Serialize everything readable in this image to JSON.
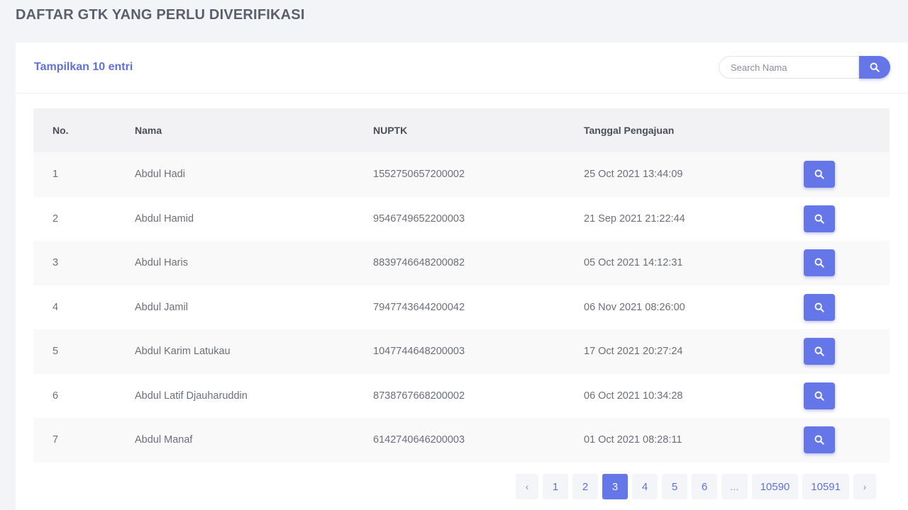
{
  "page_title": "DAFTAR GTK YANG PERLU DIVERIFIKASI",
  "entries_label": "Tampilkan 10 entri",
  "search": {
    "placeholder": "Search Nama",
    "icon": "search-icon"
  },
  "table": {
    "headers": [
      "No.",
      "Nama",
      "NUPTK",
      "Tanggal Pengajuan"
    ],
    "rows": [
      {
        "no": "1",
        "nama": "Abdul Hadi",
        "nuptk": "1552750657200002",
        "tanggal": "25 Oct 2021 13:44:09"
      },
      {
        "no": "2",
        "nama": "Abdul Hamid",
        "nuptk": "9546749652200003",
        "tanggal": "21 Sep 2021 21:22:44"
      },
      {
        "no": "3",
        "nama": "Abdul Haris",
        "nuptk": "8839746648200082",
        "tanggal": "05 Oct 2021 14:12:31"
      },
      {
        "no": "4",
        "nama": "Abdul Jamil",
        "nuptk": "7947743644200042",
        "tanggal": "06 Nov 2021 08:26:00"
      },
      {
        "no": "5",
        "nama": "Abdul Karim Latukau",
        "nuptk": "1047744648200003",
        "tanggal": "17 Oct 2021 20:27:24"
      },
      {
        "no": "6",
        "nama": "Abdul Latif Djauharuddin",
        "nuptk": "8738767668200002",
        "tanggal": "06 Oct 2021 10:34:28"
      },
      {
        "no": "7",
        "nama": "Abdul Manaf",
        "nuptk": "6142740646200003",
        "tanggal": "01 Oct 2021 08:28:11"
      }
    ]
  },
  "pagination": {
    "prev": "‹",
    "pages": [
      "1",
      "2",
      "3",
      "4",
      "5",
      "6",
      "...",
      "10590",
      "10591"
    ],
    "active": "3",
    "next": "›"
  },
  "colors": {
    "accent": "#6476e8",
    "title": "#5a5f6b",
    "link": "#5f72d9"
  }
}
